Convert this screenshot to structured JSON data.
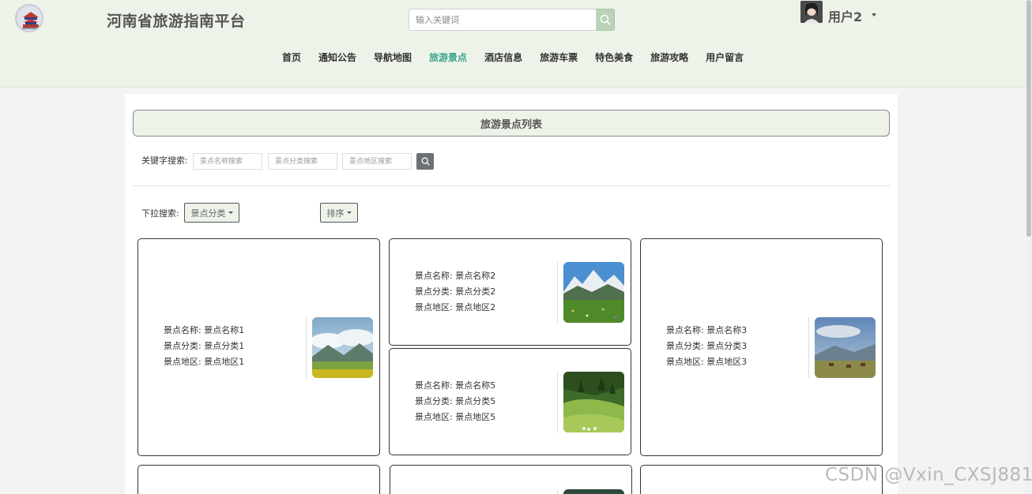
{
  "header": {
    "site_title": "河南省旅游指南平台",
    "search_placeholder": "输入关键词",
    "user_name": "用户2"
  },
  "nav": {
    "items": [
      "首页",
      "通知公告",
      "导航地图",
      "旅游景点",
      "酒店信息",
      "旅游车票",
      "特色美食",
      "旅游攻略",
      "用户留言"
    ],
    "active_index": 3
  },
  "list": {
    "title": "旅游景点列表",
    "keyword_label": "关键字搜索:",
    "keyword_placeholders": [
      "景点名称搜索",
      "景点分类搜索",
      "景点地区搜索"
    ],
    "dropdown_label": "下拉搜索:",
    "category_button": "景点分类",
    "sort_button": "排序"
  },
  "cards": [
    {
      "name_label": "景点名称:",
      "name": "景点名称1",
      "category_label": "景点分类:",
      "category": "景点分类1",
      "region_label": "景点地区:",
      "region": "景点地区1"
    },
    {
      "name_label": "景点名称:",
      "name": "景点名称2",
      "category_label": "景点分类:",
      "category": "景点分类2",
      "region_label": "景点地区:",
      "region": "景点地区2"
    },
    {
      "name_label": "景点名称:",
      "name": "景点名称3",
      "category_label": "景点分类:",
      "category": "景点分类3",
      "region_label": "景点地区:",
      "region": "景点地区3"
    },
    {
      "name_label": "景点名称:",
      "name": "景点名称5",
      "category_label": "景点分类:",
      "category": "景点分类5",
      "region_label": "景点地区:",
      "region": "景点地区5"
    }
  ],
  "watermark": "CSDN @Vxin_CXSJ881",
  "colors": {
    "header_bg": "#eef3ea",
    "active_nav": "#3ba688",
    "search_btn": "#b9d3b8"
  }
}
